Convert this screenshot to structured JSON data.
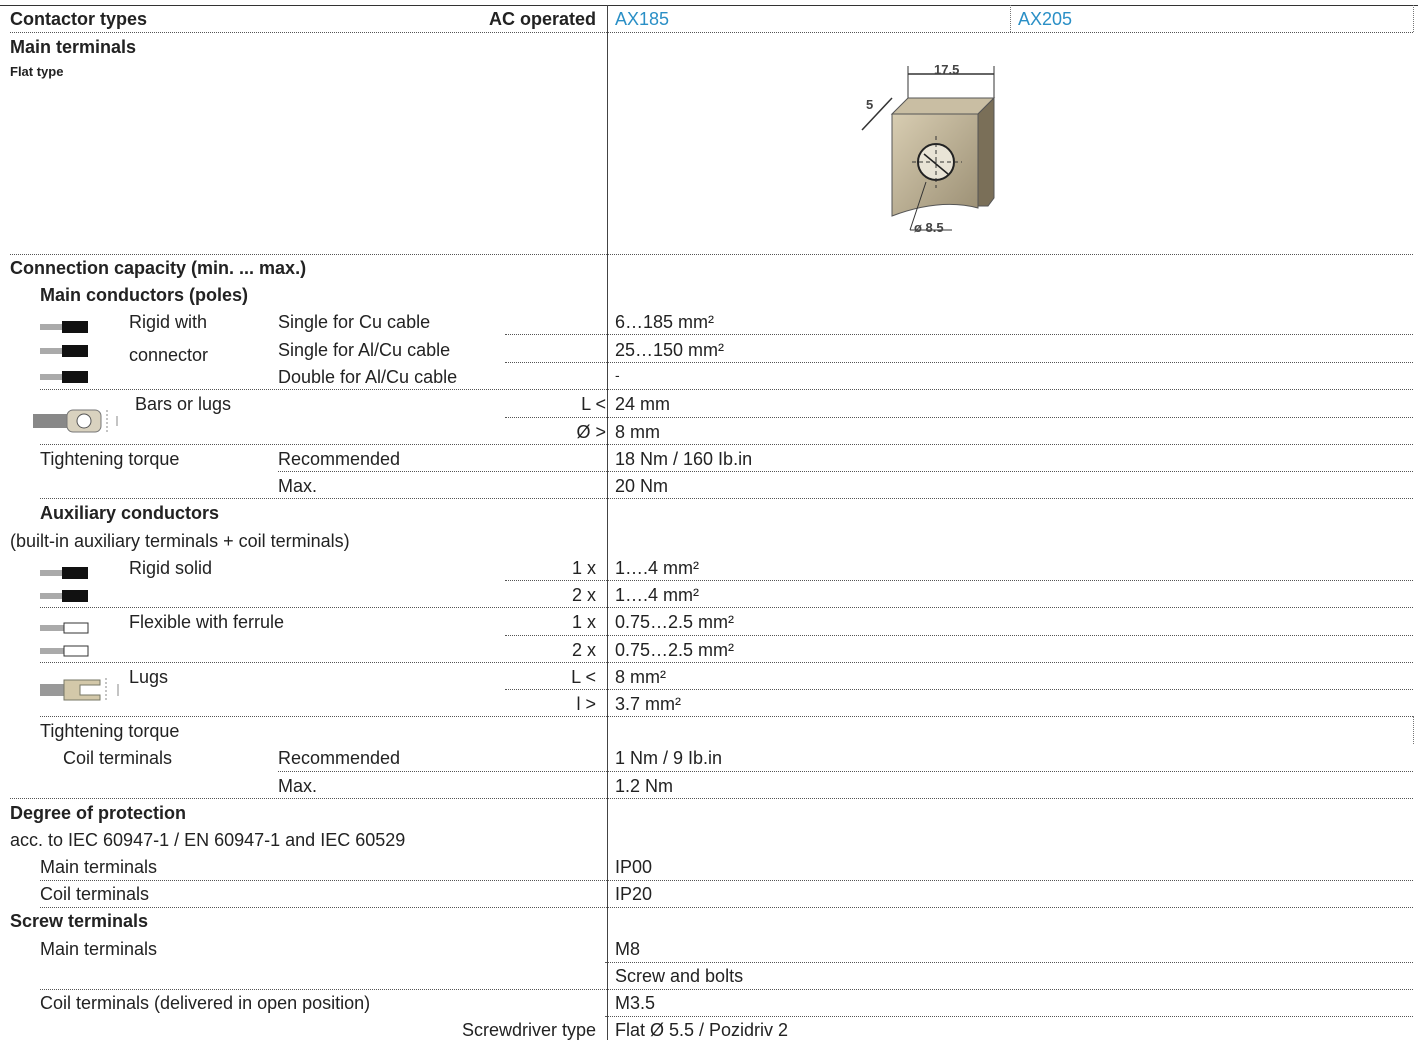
{
  "header": {
    "contactor_types": "Contactor types",
    "ac_operated": "AC operated",
    "col1": "AX185",
    "col2": "AX205"
  },
  "main_terminals": {
    "title": "Main terminals",
    "flat_type": "Flat type",
    "drawing": {
      "width": "17.5",
      "thickness": "5",
      "hole": "ø 8.5"
    }
  },
  "connection_capacity": {
    "title": "Connection capacity (min. ... max.)",
    "main_conductors": "Main conductors (poles)",
    "rigid_with": "Rigid with",
    "connector": "connector",
    "single_cu": "Single for Cu cable",
    "single_cu_val": "6…185 mm²",
    "single_alcu": "Single for Al/Cu cable",
    "single_alcu_val": "25…150 mm²",
    "double_alcu": "Double for Al/Cu cable",
    "double_alcu_val": "-",
    "bars_or_lugs": "Bars or lugs",
    "l_less": "L <",
    "l_less_val": "24 mm",
    "d_greater": "Ø >",
    "d_greater_val": "8 mm",
    "tightening_torque": "Tightening torque",
    "recommended": "Recommended",
    "recommended_val": "18 Nm / 160 Ib.in",
    "max": "Max.",
    "max_val": "20 Nm"
  },
  "auxiliary": {
    "title": "Auxiliary conductors",
    "subtitle": "(built-in auxiliary terminals + coil terminals)",
    "rigid_solid": "Rigid solid",
    "rs_1x": "1 x",
    "rs_1x_val": "1….4 mm²",
    "rs_2x": "2 x",
    "rs_2x_val": "1….4 mm²",
    "flexible": "Flexible with ferrule",
    "fl_1x": "1 x",
    "fl_1x_val": "0.75…2.5 mm²",
    "fl_2x": "2 x",
    "fl_2x_val": "0.75…2.5 mm²",
    "lugs": "Lugs",
    "lugs_l": "L <",
    "lugs_l_val": "8 mm²",
    "lugs_i": "l >",
    "lugs_i_val": "3.7 mm²",
    "tightening_torque": "Tightening torque",
    "coil_terminals": "Coil terminals",
    "recommended": "Recommended",
    "recommended_val": "1 Nm / 9 Ib.in",
    "max": "Max.",
    "max_val": "1.2 Nm"
  },
  "protection": {
    "title": "Degree of protection",
    "standard": "acc. to IEC 60947-1 / EN 60947-1 and IEC 60529",
    "main_terminals": "Main terminals",
    "main_val": "IP00",
    "coil_terminals": "Coil terminals",
    "coil_val": "IP20"
  },
  "screw": {
    "title": "Screw terminals",
    "main_terminals": "Main terminals",
    "main_val1": "M8",
    "main_val2": "Screw and bolts",
    "coil_terminals": "Coil terminals (delivered in open position)",
    "coil_val": "M3.5",
    "screwdriver": "Screwdriver type",
    "screwdriver_val": "Flat Ø 5.5 / Pozidriv 2"
  }
}
